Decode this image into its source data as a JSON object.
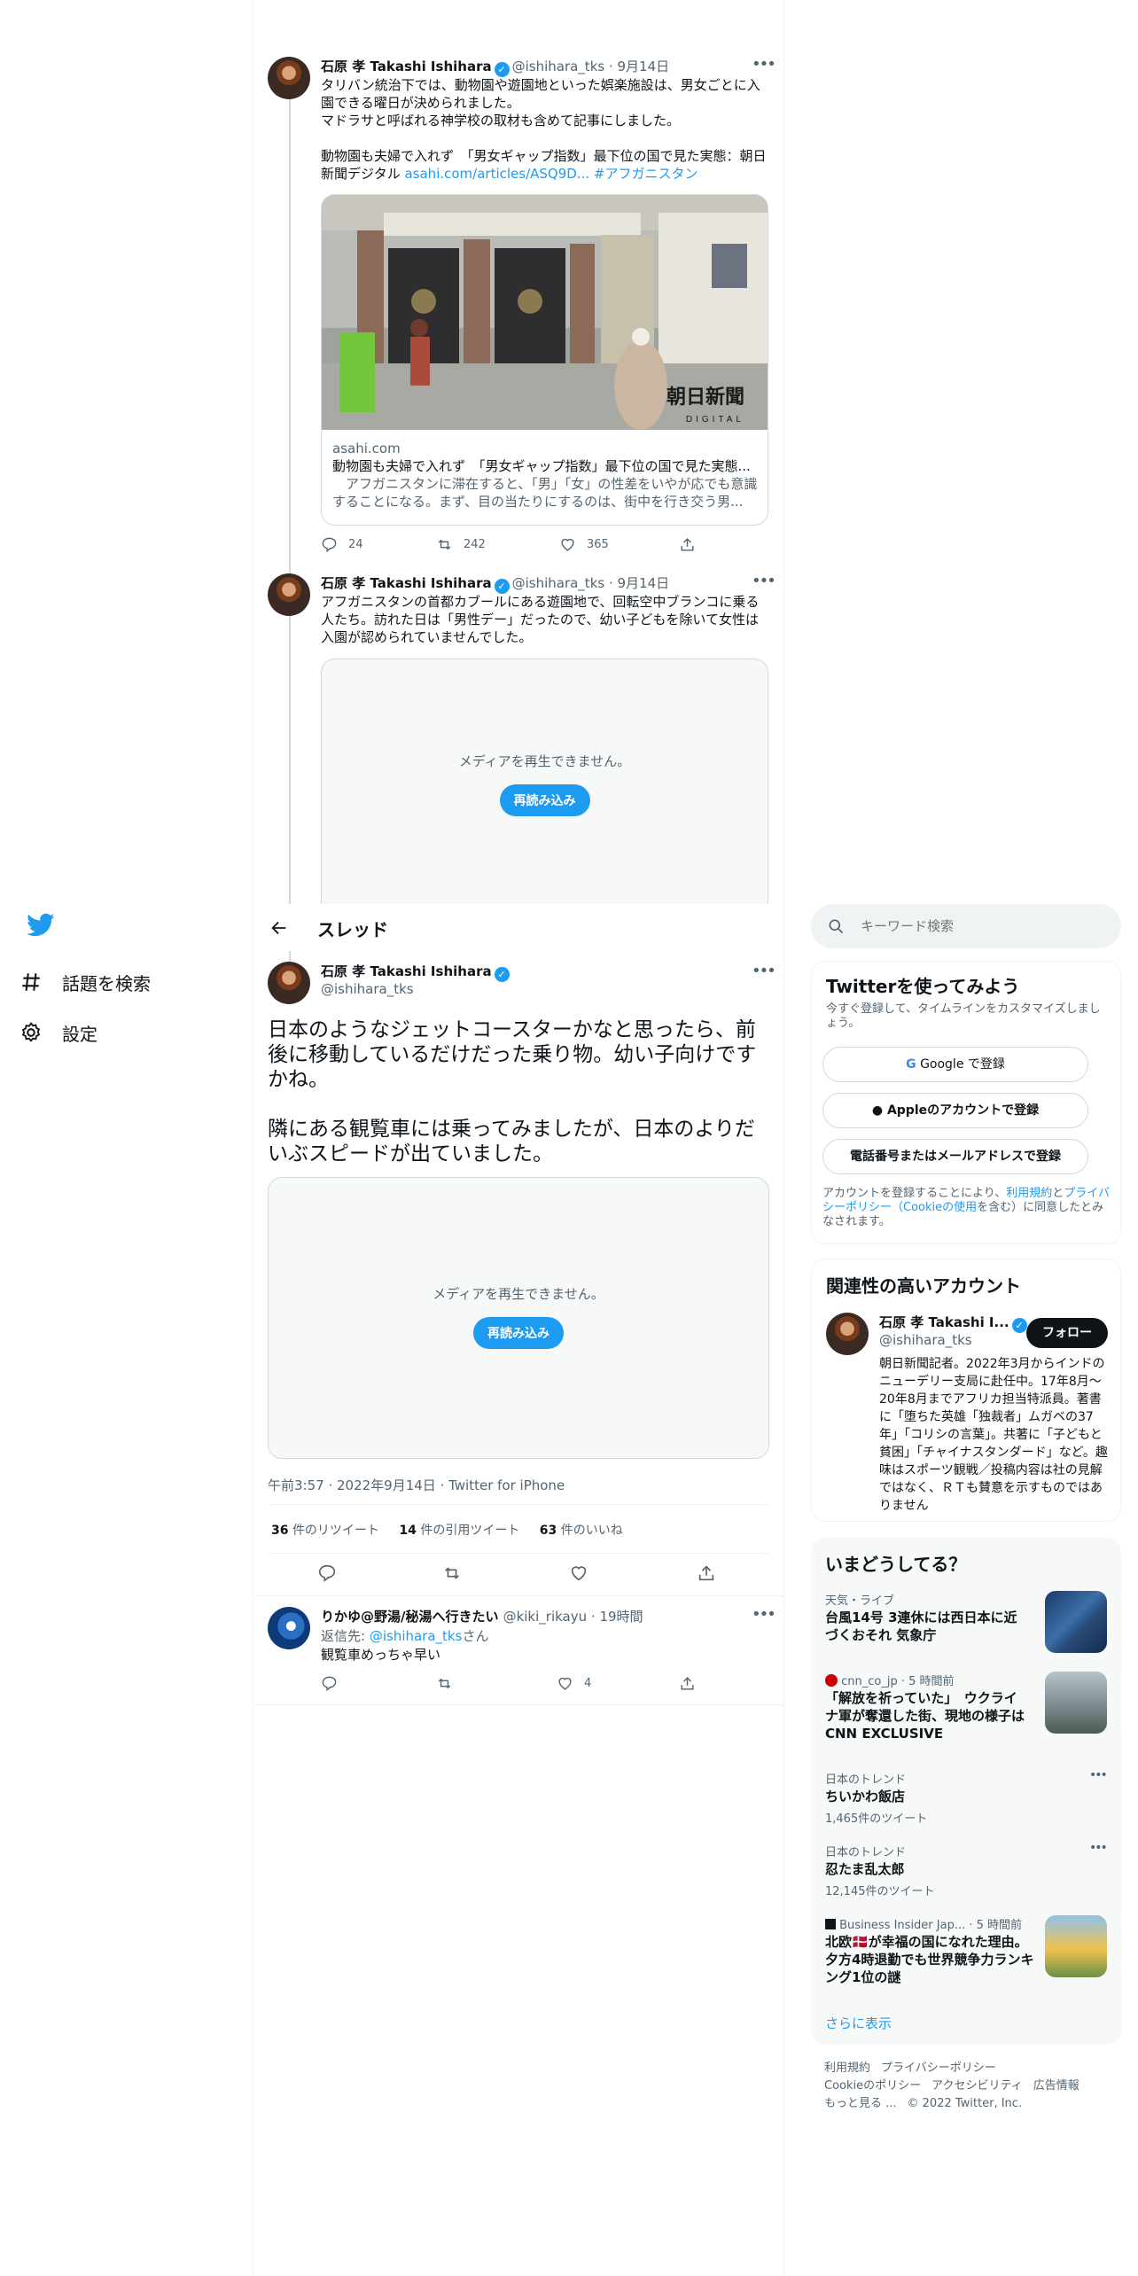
{
  "colors": {
    "accent": "#1d9bf0",
    "text": "#0f1419",
    "muted": "#536471",
    "border": "#eff3f4"
  },
  "nav": {
    "items": [
      {
        "icon": "hash-icon",
        "label": "話題を検索"
      },
      {
        "icon": "gear-icon",
        "label": "設定"
      }
    ]
  },
  "header": {
    "title": "スレッド"
  },
  "tweet1": {
    "author": "石原 孝 Takashi Ishihara",
    "handle": "@ishihara_tks",
    "time": "9月14日",
    "line1": "タリバン統治下では、動物園や遊園地といった娯楽施設は、男女ごとに入園できる曜日が決められました。",
    "line2": "マドラサと呼ばれる神学校の取材も含めて記事にしました。",
    "line3": "動物園も夫婦で入れず　「男女ギャップ指数」最下位の国で見た実態：朝日新聞デジタル",
    "link_url": "asahi.com/articles/ASQ9D...",
    "hashtag": "#アフガニスタン",
    "card": {
      "domain": "asahi.com",
      "title": "動物園も夫婦で入れず　「男女ギャップ指数」最下位の国で見た実態...",
      "desc": "　アフガニスタンに滞在すると、「男」「女」の性差をいやが応でも意識することになる。まず、目の当たりにするのは、街中を行き交う男...",
      "watermark": "朝日新聞",
      "watermark_sub": "DIGITAL"
    },
    "replies": "24",
    "retweets": "242",
    "likes": "365"
  },
  "tweet2": {
    "author": "石原 孝 Takashi Ishihara",
    "handle": "@ishihara_tks",
    "time": "9月14日",
    "text": "アフガニスタンの首都カブールにある遊園地で、回転空中ブランコに乗る人たち。訪れた日は「男性デー」だったので、幼い子どもを除いて女性は入園が認められていませんでした。",
    "media_error": "メディアを再生できません。",
    "reload": "再読み込み"
  },
  "main": {
    "author": "石原 孝 Takashi Ishihara",
    "handle": "@ishihara_tks",
    "text1": "日本のようなジェットコースターかなと思ったら、前後に移動しているだけだった乗り物。幼い子向けですかね。",
    "text2": "隣にある観覧車には乗ってみましたが、日本のよりだいぶスピードが出ていました。",
    "media_error": "メディアを再生できません。",
    "reload": "再読み込み",
    "meta": "午前3:57 · 2022年9月14日 · Twitter for iPhone",
    "retweets": "36",
    "retweets_label": "件のリツイート",
    "quotes": "14",
    "quotes_label": "件の引用ツイート",
    "likes": "63",
    "likes_label": "件のいいね"
  },
  "reply": {
    "author": "りかゆ@野湯/秘湯へ行きたい",
    "handle": "@kiki_rikayu",
    "time": "19時間",
    "reply_to_prefix": "返信先: ",
    "reply_to": "@ishihara_tks",
    "reply_to_suffix": "さん",
    "text": "観覧車めっちゃ早い",
    "likes": "4"
  },
  "search": {
    "placeholder": "キーワード検索"
  },
  "signup": {
    "title": "Twitterを使ってみよう",
    "sub": "今すぐ登録して、タイムラインをカスタマイズしましょう。",
    "google": "Google で登録",
    "apple": "Appleのアカウントで登録",
    "phone": "電話番号またはメールアドレスで登録",
    "terms_pre": "アカウントを登録することにより、",
    "terms": "利用規約",
    "and": "と",
    "privacy": "プライバシーポリシー（Cookieの使用",
    "terms_post": "を含む）に同意したとみなされます。"
  },
  "related": {
    "title": "関連性の高いアカウント",
    "name": "石原 孝 Takashi I...",
    "handle": "@ishihara_tks",
    "follow": "フォロー",
    "bio": "朝日新聞記者。2022年3月からインドのニューデリー支局に赴任中。17年8月〜20年8月までアフリカ担当特派員。著書に「堕ちた英雄「独裁者」ムガベの37年」「コリシの言葉」。共著に「子どもと貧困」「チャイナスタンダード」など。趣味はスポーツ観戦／投稿内容は社の見解ではなく、ＲＴも賛意を示すものではありません"
  },
  "trends": {
    "title": "いまどうしてる？",
    "items": [
      {
        "cat": "天気・ライブ",
        "title": "台風14号 3連休には西日本に近づくおそれ 気象庁"
      },
      {
        "cat": "cnn_co_jp · 5 時間前",
        "title": "「解放を祈っていた」　ウクライナ軍が奪還した街、現地の様子はCNN EXCLUSIVE"
      },
      {
        "cat": "日本のトレンド",
        "title": "ちいかわ飯店",
        "count": "1,465件のツイート"
      },
      {
        "cat": "日本のトレンド",
        "title": "忍たま乱太郎",
        "count": "12,145件のツイート"
      },
      {
        "cat": "Business Insider Jap... · 5 時間前",
        "title": "北欧🇩🇰が幸福の国になれた理由。夕方4時退勤でも世界競争力ランキング1位の謎"
      }
    ],
    "more": "さらに表示"
  },
  "footer": {
    "row1": [
      "利用規約",
      "プライバシーポリシー"
    ],
    "row2": [
      "Cookieのポリシー",
      "アクセシビリティ",
      "広告情報"
    ],
    "more": "もっと見る ...",
    "copyright": "© 2022 Twitter, Inc."
  }
}
